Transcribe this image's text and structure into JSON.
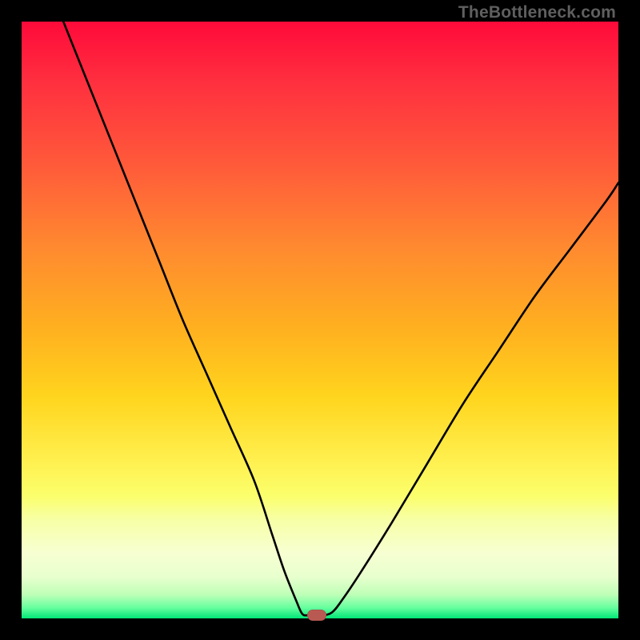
{
  "watermark": "TheBottleneck.com",
  "chart_data": {
    "type": "line",
    "title": "",
    "xlabel": "",
    "ylabel": "",
    "xlim": [
      0,
      100
    ],
    "ylim": [
      0,
      100
    ],
    "grid": false,
    "series": [
      {
        "name": "bottleneck-curve",
        "x": [
          7,
          11,
          15,
          19,
          23,
          27,
          31,
          35,
          39,
          42,
          44,
          46,
          47,
          48,
          50,
          52,
          54,
          57,
          62,
          68,
          74,
          80,
          86,
          92,
          98,
          100
        ],
        "y": [
          100,
          90,
          80,
          70,
          60,
          50,
          41,
          32,
          23,
          14,
          8,
          3,
          0.8,
          0.5,
          0.5,
          1,
          3.5,
          8,
          16,
          26,
          36,
          45,
          54,
          62,
          70,
          73
        ]
      }
    ],
    "marker": {
      "x": 49.5,
      "y": 0.6,
      "color": "#b95a52"
    },
    "gradient_stops": [
      {
        "pct": 0,
        "color": "#ff0a3a"
      },
      {
        "pct": 24,
        "color": "#ff5a3a"
      },
      {
        "pct": 52,
        "color": "#ffb21f"
      },
      {
        "pct": 74,
        "color": "#fff151"
      },
      {
        "pct": 93,
        "color": "#e8ffce"
      },
      {
        "pct": 100,
        "color": "#00e676"
      }
    ]
  }
}
